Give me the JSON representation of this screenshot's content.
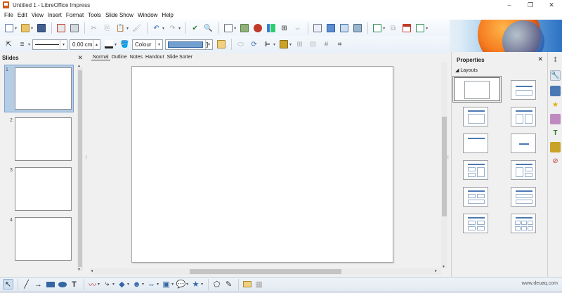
{
  "window": {
    "title": "Untitled 1 - LibreOffice Impress",
    "minimize": "–",
    "maximize": "❐",
    "close": "✕"
  },
  "menu": [
    "File",
    "Edit",
    "View",
    "Insert",
    "Format",
    "Tools",
    "Slide Show",
    "Window",
    "Help"
  ],
  "toolbar2": {
    "line_width": "0.00 cm",
    "fill_style": "Colour",
    "fill_color_value": "[]",
    "fill_color_hex": "#729fcf"
  },
  "slides_pane": {
    "title": "Slides",
    "close": "✕",
    "slides": [
      "1",
      "2",
      "3",
      "4"
    ],
    "selected": 1
  },
  "view_tabs": [
    "Normal",
    "Outline",
    "Notes",
    "Handout",
    "Slide Sorter"
  ],
  "active_tab": "Normal",
  "properties": {
    "title": "Properties",
    "close": "✕",
    "section": "Layouts",
    "layouts": [
      "Blank Slide",
      "Title Slide",
      "Title, Content",
      "Title and 2 Content",
      "Title Only",
      "Centred Text",
      "Title, 2 Content and Content",
      "Title, Content and 2 Content",
      "Title, 2 Content over Content",
      "Title, Content over Content",
      "Title, 4 Content",
      "Title, 6 Content"
    ]
  },
  "watermark": "www.deuaq.com",
  "colors": {
    "accent": "#729fcf",
    "selection": "#b6cde6",
    "layout_title_bar": "#4a78b5"
  }
}
